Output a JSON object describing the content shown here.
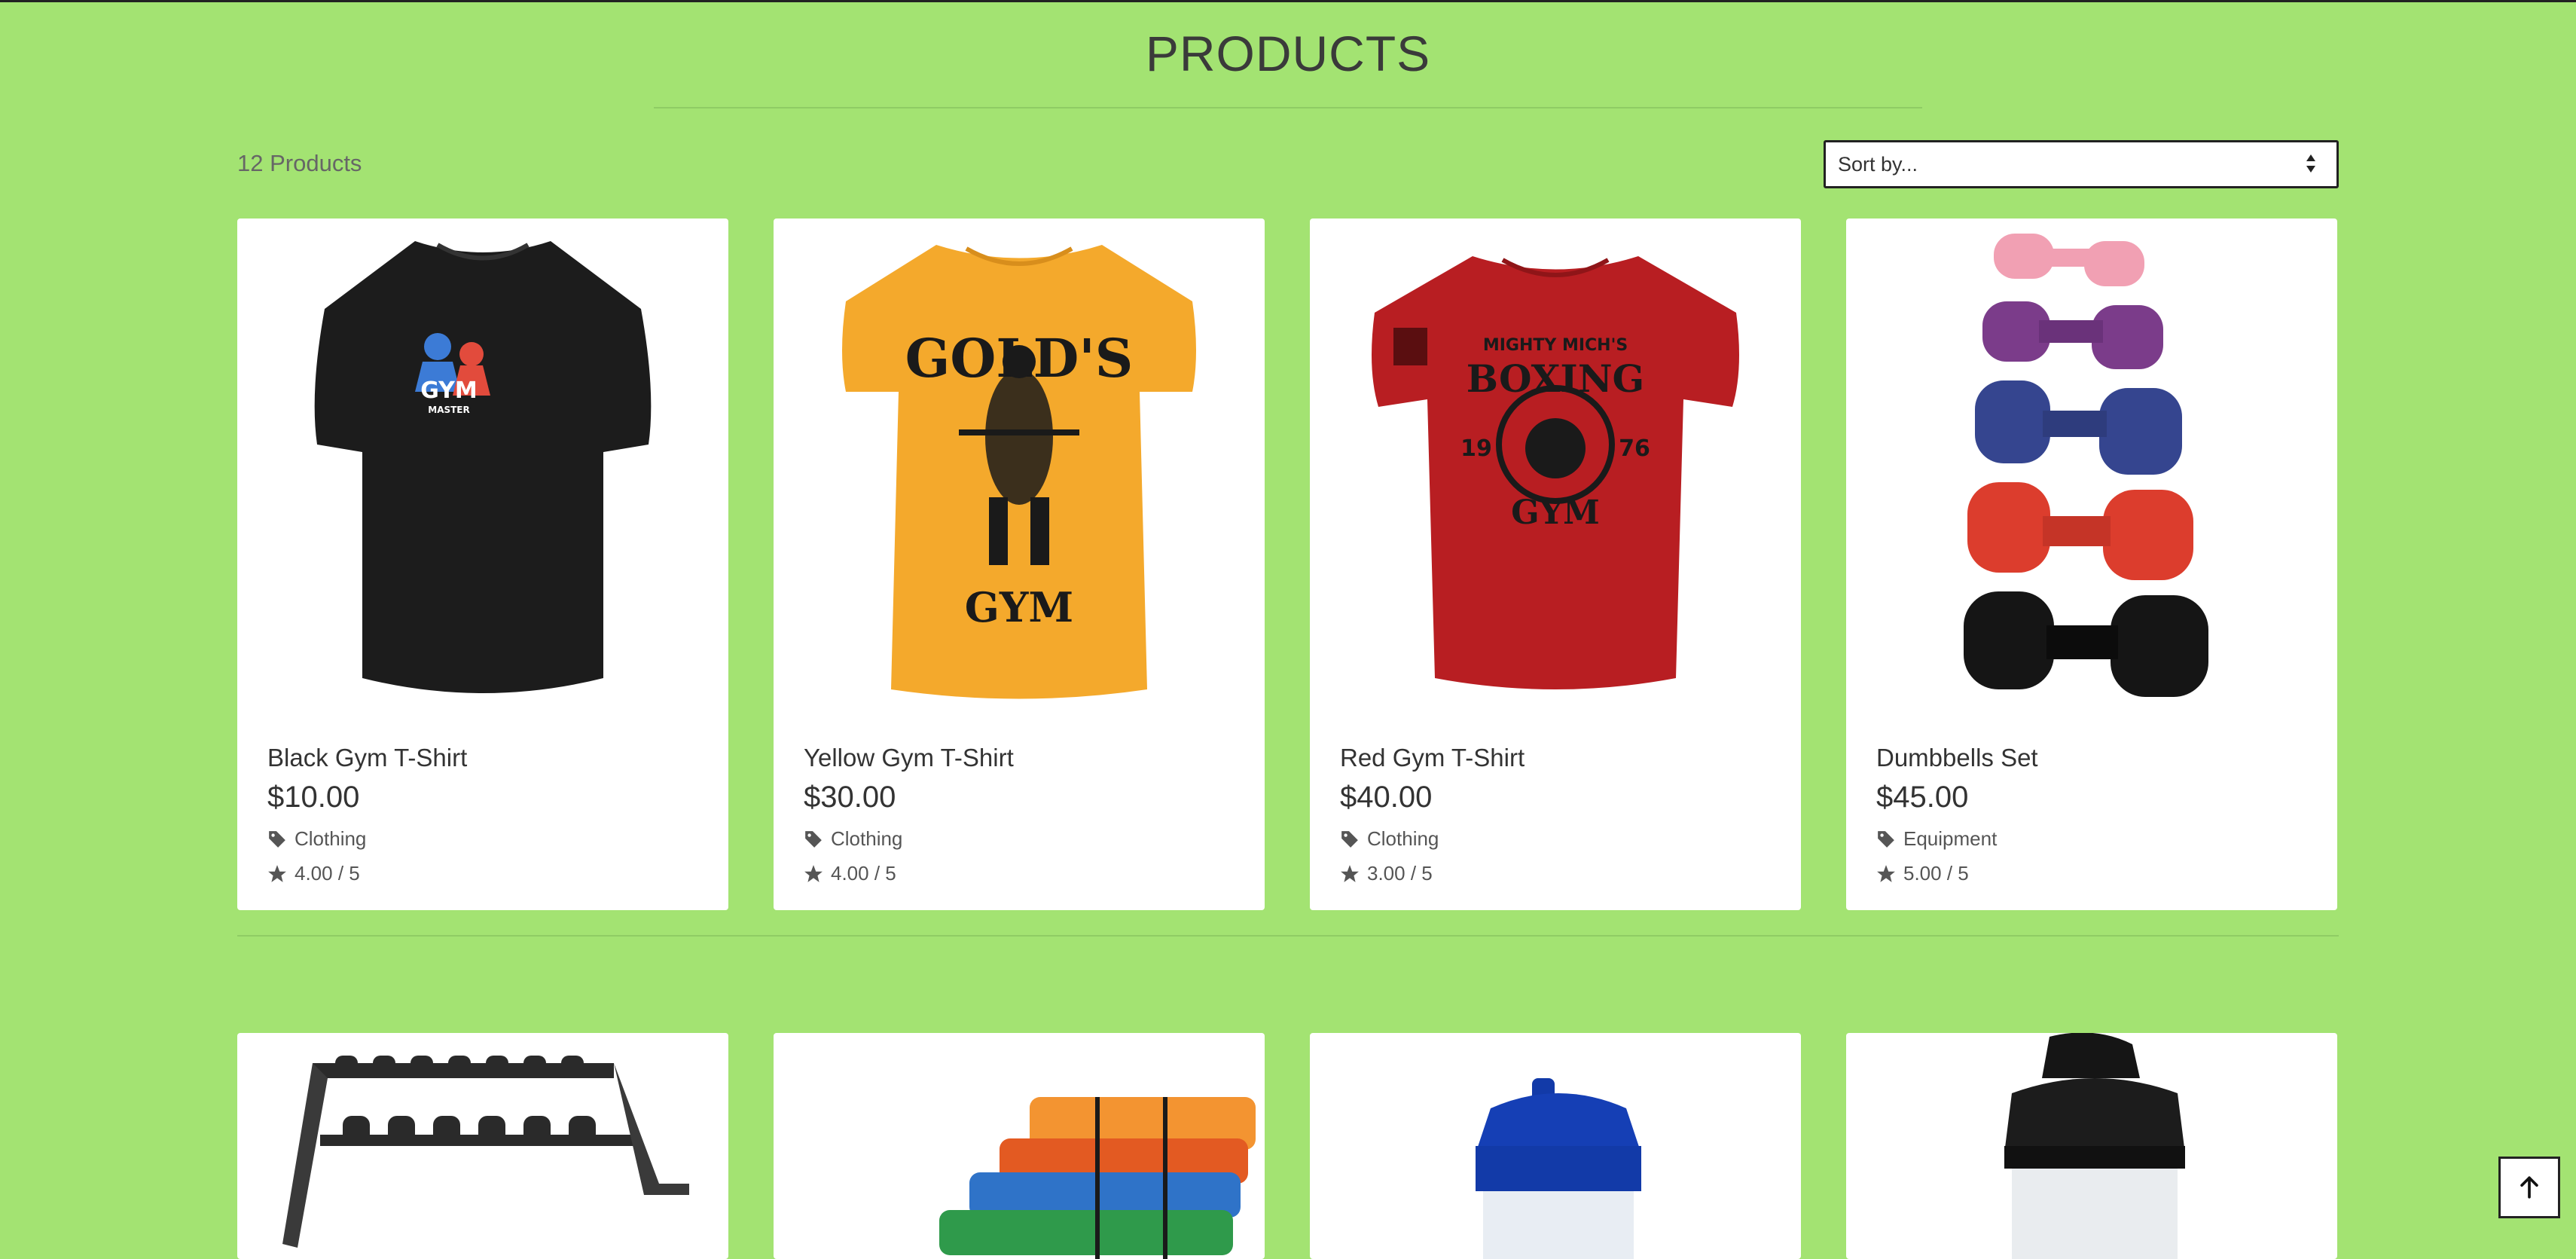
{
  "header": {
    "title": "PRODUCTS",
    "product_count": "12 Products"
  },
  "sort": {
    "selected": "Sort by..."
  },
  "products": [
    {
      "name": "Black Gym T-Shirt",
      "price": "$10.00",
      "category": "Clothing",
      "rating": "4.00 / 5",
      "image": "black-tshirt-gym-master",
      "color": "#1c1c1c"
    },
    {
      "name": "Yellow Gym T-Shirt",
      "price": "$30.00",
      "category": "Clothing",
      "rating": "4.00 / 5",
      "image": "yellow-tshirt-golds-gym",
      "color": "#f4a92c"
    },
    {
      "name": "Red Gym T-Shirt",
      "price": "$40.00",
      "category": "Clothing",
      "rating": "3.00 / 5",
      "image": "red-tshirt-boxing-gym",
      "color": "#b81e22"
    },
    {
      "name": "Dumbbells Set",
      "price": "$45.00",
      "category": "Equipment",
      "rating": "5.00 / 5",
      "image": "dumbbells-stack",
      "color": "#cc2f2a"
    },
    {
      "image": "dumbbell-rack"
    },
    {
      "image": "resistance-bands"
    },
    {
      "image": "blue-shaker-bottle"
    },
    {
      "image": "black-shaker-bottle"
    }
  ],
  "tshirt_art": {
    "black": "GYM",
    "black_sub": "MASTER",
    "yellow_top": "GOLD'S",
    "yellow_bottom": "GYM",
    "red_top": "MIGHTY MICH'S",
    "red_mid": "BOXING",
    "red_year_left": "19",
    "red_year_right": "76",
    "red_bottom": "GYM"
  },
  "icons": {
    "category": "tag-icon",
    "rating": "star-icon",
    "back_to_top": "arrow-up-icon"
  }
}
